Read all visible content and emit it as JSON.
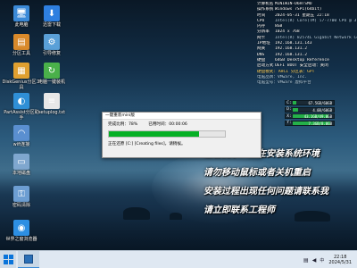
{
  "desktop_icons": [
    {
      "label": "此电脑",
      "glyph": "🖥",
      "color": "#3b8ad8",
      "icon_name": "computer-icon"
    },
    {
      "label": "迅雷下载",
      "glyph": "⬇",
      "color": "#2e7fe0",
      "icon_name": "thunder-download-icon"
    },
    {
      "label": "分区工具",
      "glyph": "▤",
      "color": "#d98a2b",
      "icon_name": "partition-tool-icon"
    },
    {
      "label": "引导修复",
      "glyph": "⚙",
      "color": "#5aa0d8",
      "icon_name": "boot-repair-icon"
    },
    {
      "label": "DiskGenius分区工具",
      "glyph": "▦",
      "color": "#e0a030",
      "icon_name": "diskgenius-icon"
    },
    {
      "label": "电脑一键装机",
      "glyph": "↻",
      "color": "#4ab04a",
      "icon_name": "one-key-install-icon"
    },
    {
      "label": "PartAssist分区助手",
      "glyph": "◐",
      "color": "#2f8fd6",
      "icon_name": "partassist-icon"
    },
    {
      "label": "setuplog.txt",
      "glyph": "≡",
      "color": "#e8e8e8",
      "icon_name": "text-file-icon"
    },
    {
      "label": "wifi连接",
      "glyph": "◠",
      "color": "#5a8fd0",
      "icon_name": "wifi-icon"
    },
    {
      "label": "本地磁盘",
      "glyph": "▭",
      "color": "#7fa7cf",
      "icon_name": "local-disk-icon"
    },
    {
      "label": "密码清除",
      "glyph": "⚿",
      "color": "#6d9ed2",
      "icon_name": "password-clear-icon"
    },
    {
      "label": "世界之窗浏览器",
      "glyph": "◉",
      "color": "#2d8fe3",
      "icon_name": "browser-icon"
    }
  ],
  "sysinfo": {
    "rows": [
      {
        "k": "计算机名",
        "v": "MINIWIN-D6HTSMO"
      },
      {
        "k": "操作系统",
        "v": "Windows 7SP1(64bit)"
      },
      {
        "k": "时间",
        "v": "2024-05-31 星期五 22:18"
      },
      {
        "k": "CPU",
        "v": "Intel(R) Core(TM) i7-7700 CPU @ 3.60GHz"
      },
      {
        "k": "内存",
        "v": "8GB"
      },
      {
        "k": "分辨率",
        "v": "1024 x 768"
      },
      {
        "k": "网卡",
        "v": "Intel(R) 82574L Gigabit Network Connection"
      },
      {
        "k": "IP地址",
        "v": "192.168.131.143"
      },
      {
        "k": "网关",
        "v": "192.168.131.2"
      },
      {
        "k": "DNS",
        "v": "192.168.131.2"
      },
      {
        "k": "硬盘",
        "v": "64GB Desktop Reference"
      },
      {
        "k": "启动方式",
        "v": "UEFI BOOT 安全启动：关闭"
      }
    ],
    "lines": [
      "硬盘模式: AHCI 分区表：GPT",
      "电脑品牌：VMware, Inc.",
      "电脑型号：VMware 虚拟平台"
    ]
  },
  "drives": [
    {
      "letter": "C:",
      "text": "67.5GB/60GB",
      "fill_pct": 8
    },
    {
      "letter": "D:",
      "text": "4.0B/60GB",
      "fill_pct": 12
    },
    {
      "letter": "X:",
      "text": "43.1GB/49.0GB",
      "fill_pct": 88
    },
    {
      "letter": "Y:",
      "text": "7.3GB/8.0GB",
      "fill_pct": 91
    }
  ],
  "notice": [
    "温馨提示：正在安装系统环境",
    "请勿移动鼠标或者关机重启",
    "安装过程出现任何问题请联系我",
    "请立即联系工程师"
  ],
  "dialog": {
    "title": "一键重装mini版",
    "complete_label": "完成比例：",
    "complete_value": "78%",
    "elapsed_label": "已用时间：",
    "elapsed_value": "00:00:06",
    "progress_pct": 78,
    "status": "正在还原 [C:] [Creating files]，请稍候。"
  },
  "taskbar": {
    "lang": "中",
    "time": "22:18",
    "date": "2024/5/31"
  },
  "colors": {
    "progress": "#06b025",
    "drive_bar": "#25b04a",
    "accent": "#0a74da"
  }
}
